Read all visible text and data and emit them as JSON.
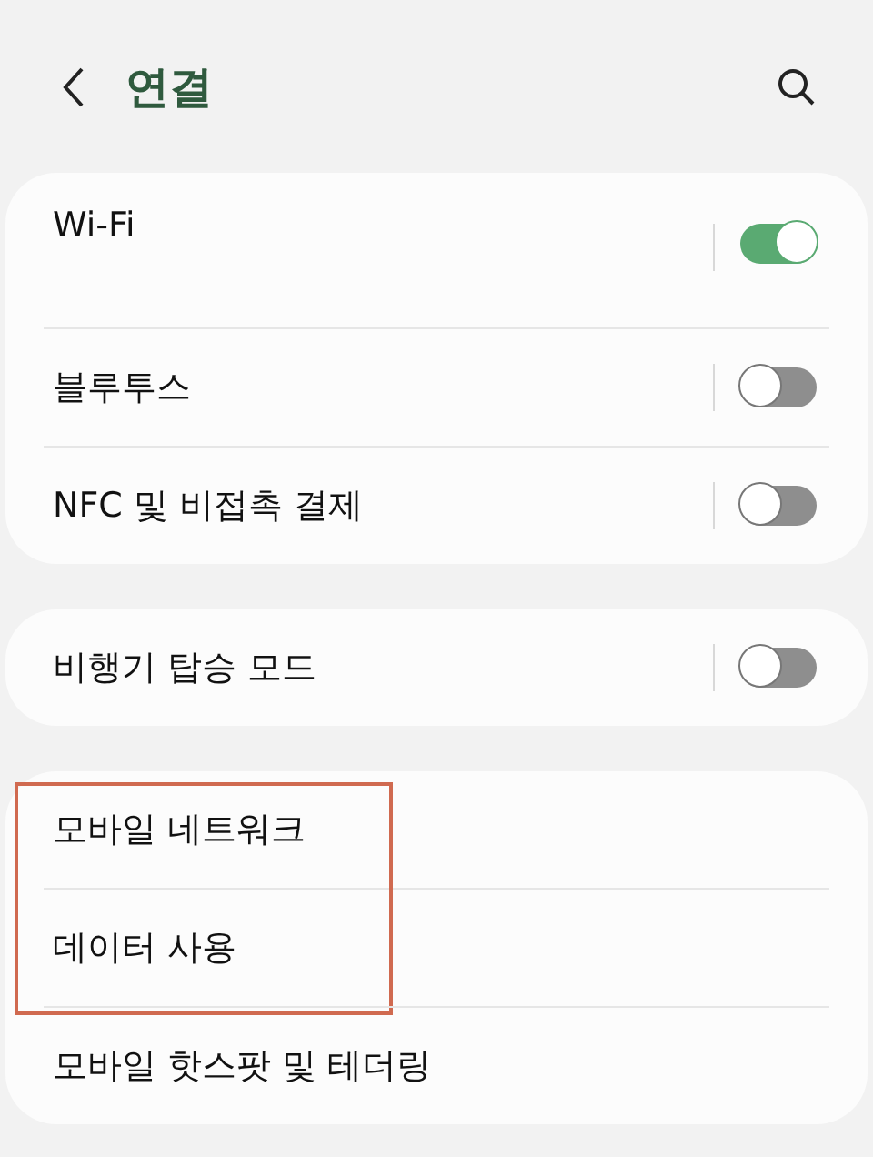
{
  "header": {
    "title": "연결"
  },
  "cards": [
    {
      "rows": [
        {
          "label": "Wi-Fi",
          "kind": "toggle",
          "on": true,
          "tall": true,
          "highlighted": false
        },
        {
          "label": "블루투스",
          "kind": "toggle",
          "on": false,
          "tall": false,
          "highlighted": false
        },
        {
          "label": "NFC 및 비접촉 결제",
          "kind": "toggle",
          "on": false,
          "tall": false,
          "highlighted": false
        }
      ]
    },
    {
      "rows": [
        {
          "label": "비행기 탑승 모드",
          "kind": "toggle",
          "on": false,
          "tall": false,
          "highlighted": false
        }
      ]
    },
    {
      "rows": [
        {
          "label": "모바일 네트워크",
          "kind": "link",
          "highlighted": true
        },
        {
          "label": "데이터 사용",
          "kind": "link",
          "highlighted": true
        },
        {
          "label": "모바일 핫스팟 및 테더링",
          "kind": "link",
          "highlighted": false
        }
      ]
    }
  ]
}
